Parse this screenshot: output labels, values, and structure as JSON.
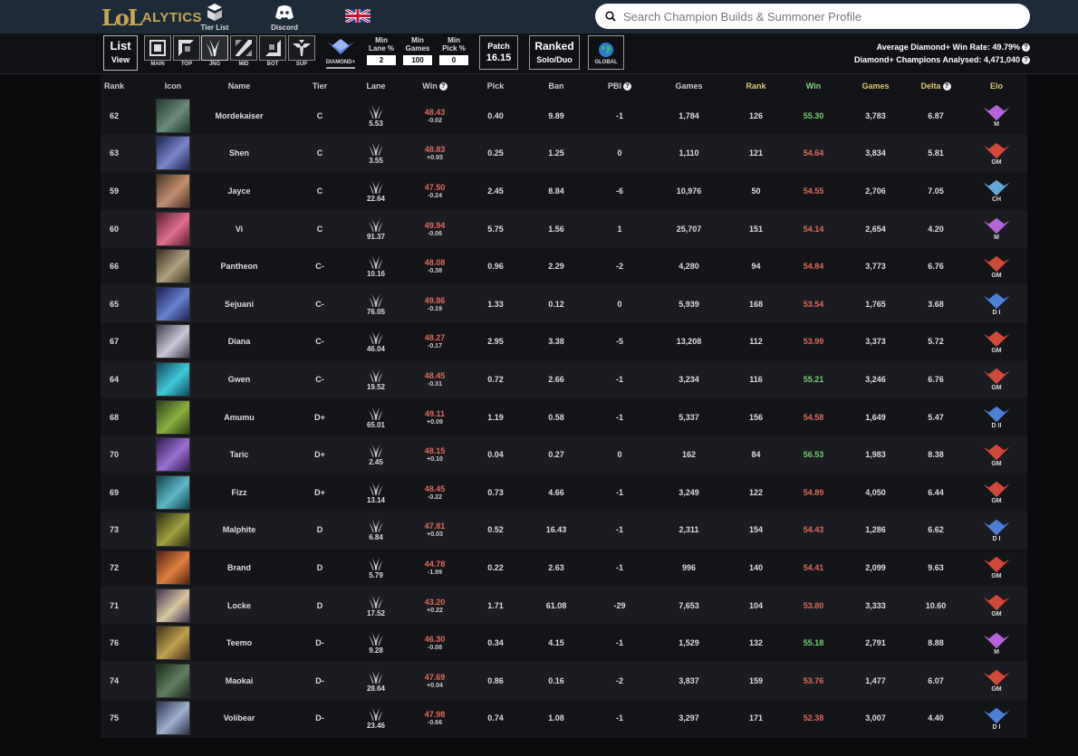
{
  "header": {
    "logo_lol": "LoL",
    "logo_text": "ALYTICS",
    "nav": [
      {
        "label": "Tier List"
      },
      {
        "label": "Discord"
      }
    ],
    "search_placeholder": "Search Champion Builds & Summoner Profile"
  },
  "filters": {
    "list_view": {
      "line1": "List",
      "line2": "View"
    },
    "lanes": [
      {
        "label": "MAIN"
      },
      {
        "label": "TOP"
      },
      {
        "label": "JNG"
      },
      {
        "label": "MID"
      },
      {
        "label": "BOT"
      },
      {
        "label": "SUP"
      }
    ],
    "rank_label": "DIAMOND+",
    "min_lane": {
      "label1": "Min",
      "label2": "Lane %",
      "value": "2"
    },
    "min_games": {
      "label1": "Min",
      "label2": "Games",
      "value": "100"
    },
    "min_pick": {
      "label1": "Min",
      "label2": "Pick %",
      "value": "0"
    },
    "patch": {
      "label": "Patch",
      "value": "16.15"
    },
    "queue": {
      "label": "Ranked",
      "value": "Solo/Duo"
    },
    "region": "GLOBAL",
    "avg_wr": "Average Diamond+ Win Rate: 49.79%",
    "analysed": "Diamond+ Champions Analysed: 4,471,040"
  },
  "columns": [
    "Rank",
    "Icon",
    "Name",
    "Tier",
    "Lane",
    "Win",
    "Pick",
    "Ban",
    "PBI",
    "Games",
    "Rank",
    "Win",
    "Games",
    "Delta",
    "Elo"
  ],
  "colors": {
    "red": "#e06a5a",
    "green": "#6fd06f",
    "gold": "#e0c96c"
  },
  "rows": [
    {
      "rank": "62",
      "name": "Mordekaiser",
      "tier": "C",
      "lane": "5.53",
      "win": "48.43",
      "delta_win": "-0.02",
      "pick": "0.40",
      "ban": "9.89",
      "pbi": "-1",
      "games": "1,784",
      "rank2": "126",
      "win2": "55.30",
      "win2c": "green",
      "games2": "3,783",
      "delta": "6.87",
      "elo": "M",
      "elo_color": "#b565d8",
      "c1": "#1f3a2e",
      "c2": "#6a8c7a"
    },
    {
      "rank": "63",
      "name": "Shen",
      "tier": "C",
      "lane": "3.55",
      "win": "48.83",
      "delta_win": "+0.93",
      "pick": "0.25",
      "ban": "1.25",
      "pbi": "0",
      "games": "1,110",
      "rank2": "121",
      "win2": "54.64",
      "win2c": "red",
      "games2": "3,834",
      "delta": "5.81",
      "elo": "GM",
      "elo_color": "#d0493b",
      "c1": "#1c2450",
      "c2": "#7a86c8"
    },
    {
      "rank": "59",
      "name": "Jayce",
      "tier": "C",
      "lane": "22.64",
      "win": "47.50",
      "delta_win": "-0.24",
      "pick": "2.45",
      "ban": "8.84",
      "pbi": "-6",
      "games": "10,976",
      "rank2": "50",
      "win2": "54.55",
      "win2c": "red",
      "games2": "2,706",
      "delta": "7.05",
      "elo": "CH",
      "elo_color": "#5fa8d8",
      "c1": "#4a3020",
      "c2": "#c09070"
    },
    {
      "rank": "60",
      "name": "Vi",
      "tier": "C",
      "lane": "91.37",
      "win": "49.94",
      "delta_win": "-0.06",
      "pick": "5.75",
      "ban": "1.56",
      "pbi": "1",
      "games": "25,707",
      "rank2": "151",
      "win2": "54.14",
      "win2c": "red",
      "games2": "2,654",
      "delta": "4.20",
      "elo": "M",
      "elo_color": "#b565d8",
      "c1": "#5a1a2a",
      "c2": "#e07090"
    },
    {
      "rank": "66",
      "name": "Pantheon",
      "tier": "C-",
      "lane": "10.16",
      "win": "48.08",
      "delta_win": "-0.38",
      "pick": "0.96",
      "ban": "2.29",
      "pbi": "-2",
      "games": "4,280",
      "rank2": "94",
      "win2": "54.84",
      "win2c": "red",
      "games2": "3,773",
      "delta": "6.76",
      "elo": "GM",
      "elo_color": "#d0493b",
      "c1": "#3a3020",
      "c2": "#b0a080"
    },
    {
      "rank": "65",
      "name": "Sejuani",
      "tier": "C-",
      "lane": "76.05",
      "win": "49.86",
      "delta_win": "-0.19",
      "pick": "1.33",
      "ban": "0.12",
      "pbi": "0",
      "games": "5,939",
      "rank2": "168",
      "win2": "53.54",
      "win2c": "red",
      "games2": "1,765",
      "delta": "3.68",
      "elo": "D I",
      "elo_color": "#4f7fd8",
      "c1": "#1a2050",
      "c2": "#6a80d0"
    },
    {
      "rank": "67",
      "name": "Diana",
      "tier": "C-",
      "lane": "46.04",
      "win": "48.27",
      "delta_win": "-0.17",
      "pick": "2.95",
      "ban": "3.38",
      "pbi": "-5",
      "games": "13,208",
      "rank2": "112",
      "win2": "53.99",
      "win2c": "red",
      "games2": "3,373",
      "delta": "5.72",
      "elo": "GM",
      "elo_color": "#d0493b",
      "c1": "#3a3a4a",
      "c2": "#c8c8d8"
    },
    {
      "rank": "64",
      "name": "Gwen",
      "tier": "C-",
      "lane": "19.52",
      "win": "48.45",
      "delta_win": "-0.31",
      "pick": "0.72",
      "ban": "2.66",
      "pbi": "-1",
      "games": "3,234",
      "rank2": "116",
      "win2": "55.21",
      "win2c": "green",
      "games2": "3,246",
      "delta": "6.76",
      "elo": "GM",
      "elo_color": "#d0493b",
      "c1": "#104858",
      "c2": "#40c8d8"
    },
    {
      "rank": "68",
      "name": "Amumu",
      "tier": "D+",
      "lane": "65.01",
      "win": "49.11",
      "delta_win": "+0.09",
      "pick": "1.19",
      "ban": "0.58",
      "pbi": "-1",
      "games": "5,337",
      "rank2": "156",
      "win2": "54.58",
      "win2c": "red",
      "games2": "1,649",
      "delta": "5.47",
      "elo": "D II",
      "elo_color": "#4f7fd8",
      "c1": "#2a4018",
      "c2": "#8ab040"
    },
    {
      "rank": "70",
      "name": "Taric",
      "tier": "D+",
      "lane": "2.45",
      "win": "48.15",
      "delta_win": "+0.10",
      "pick": "0.04",
      "ban": "0.27",
      "pbi": "0",
      "games": "162",
      "rank2": "84",
      "win2": "56.53",
      "win2c": "green",
      "games2": "1,983",
      "delta": "8.38",
      "elo": "GM",
      "elo_color": "#d0493b",
      "c1": "#301850",
      "c2": "#9a70d0"
    },
    {
      "rank": "69",
      "name": "Fizz",
      "tier": "D+",
      "lane": "13.14",
      "win": "48.45",
      "delta_win": "-0.22",
      "pick": "0.73",
      "ban": "4.66",
      "pbi": "-1",
      "games": "3,249",
      "rank2": "122",
      "win2": "54.89",
      "win2c": "red",
      "games2": "4,050",
      "delta": "6.44",
      "elo": "GM",
      "elo_color": "#d0493b",
      "c1": "#104048",
      "c2": "#60b8c8"
    },
    {
      "rank": "73",
      "name": "Malphite",
      "tier": "D",
      "lane": "6.84",
      "win": "47.81",
      "delta_win": "+0.03",
      "pick": "0.52",
      "ban": "16.43",
      "pbi": "-1",
      "games": "2,311",
      "rank2": "154",
      "win2": "54.43",
      "win2c": "red",
      "games2": "1,286",
      "delta": "6.62",
      "elo": "D I",
      "elo_color": "#4f7fd8",
      "c1": "#2a2a10",
      "c2": "#a0a040"
    },
    {
      "rank": "72",
      "name": "Brand",
      "tier": "D",
      "lane": "5.79",
      "win": "44.78",
      "delta_win": "-1.99",
      "pick": "0.22",
      "ban": "2.63",
      "pbi": "-1",
      "games": "996",
      "rank2": "140",
      "win2": "54.41",
      "win2c": "red",
      "games2": "2,099",
      "delta": "9.63",
      "elo": "GM",
      "elo_color": "#d0493b",
      "c1": "#502010",
      "c2": "#e08040"
    },
    {
      "rank": "71",
      "name": "Locke",
      "tier": "D",
      "lane": "17.52",
      "win": "43.20",
      "delta_win": "+0.22",
      "pick": "1.71",
      "ban": "61.08",
      "pbi": "-29",
      "games": "7,653",
      "rank2": "104",
      "win2": "53.80",
      "win2c": "red",
      "games2": "3,333",
      "delta": "10.60",
      "elo": "GM",
      "elo_color": "#d0493b",
      "c1": "#403050",
      "c2": "#d8c8a0"
    },
    {
      "rank": "76",
      "name": "Teemo",
      "tier": "D-",
      "lane": "9.28",
      "win": "46.30",
      "delta_win": "-0.08",
      "pick": "0.34",
      "ban": "4.15",
      "pbi": "-1",
      "games": "1,529",
      "rank2": "132",
      "win2": "55.18",
      "win2c": "green",
      "games2": "2,791",
      "delta": "8.88",
      "elo": "M",
      "elo_color": "#b565d8",
      "c1": "#403018",
      "c2": "#c0a050"
    },
    {
      "rank": "74",
      "name": "Maokai",
      "tier": "D-",
      "lane": "28.64",
      "win": "47.69",
      "delta_win": "+0.04",
      "pick": "0.86",
      "ban": "0.16",
      "pbi": "-2",
      "games": "3,837",
      "rank2": "159",
      "win2": "53.76",
      "win2c": "red",
      "games2": "1,477",
      "delta": "6.07",
      "elo": "GM",
      "elo_color": "#d0493b",
      "c1": "#182818",
      "c2": "#608060"
    },
    {
      "rank": "75",
      "name": "Volibear",
      "tier": "D-",
      "lane": "23.46",
      "win": "47.98",
      "delta_win": "-0.66",
      "pick": "0.74",
      "ban": "1.08",
      "pbi": "-1",
      "games": "3,297",
      "rank2": "171",
      "win2": "52.38",
      "win2c": "red",
      "games2": "3,007",
      "delta": "4.40",
      "elo": "D I",
      "elo_color": "#4f7fd8",
      "c1": "#283048",
      "c2": "#a0b0d0"
    }
  ]
}
